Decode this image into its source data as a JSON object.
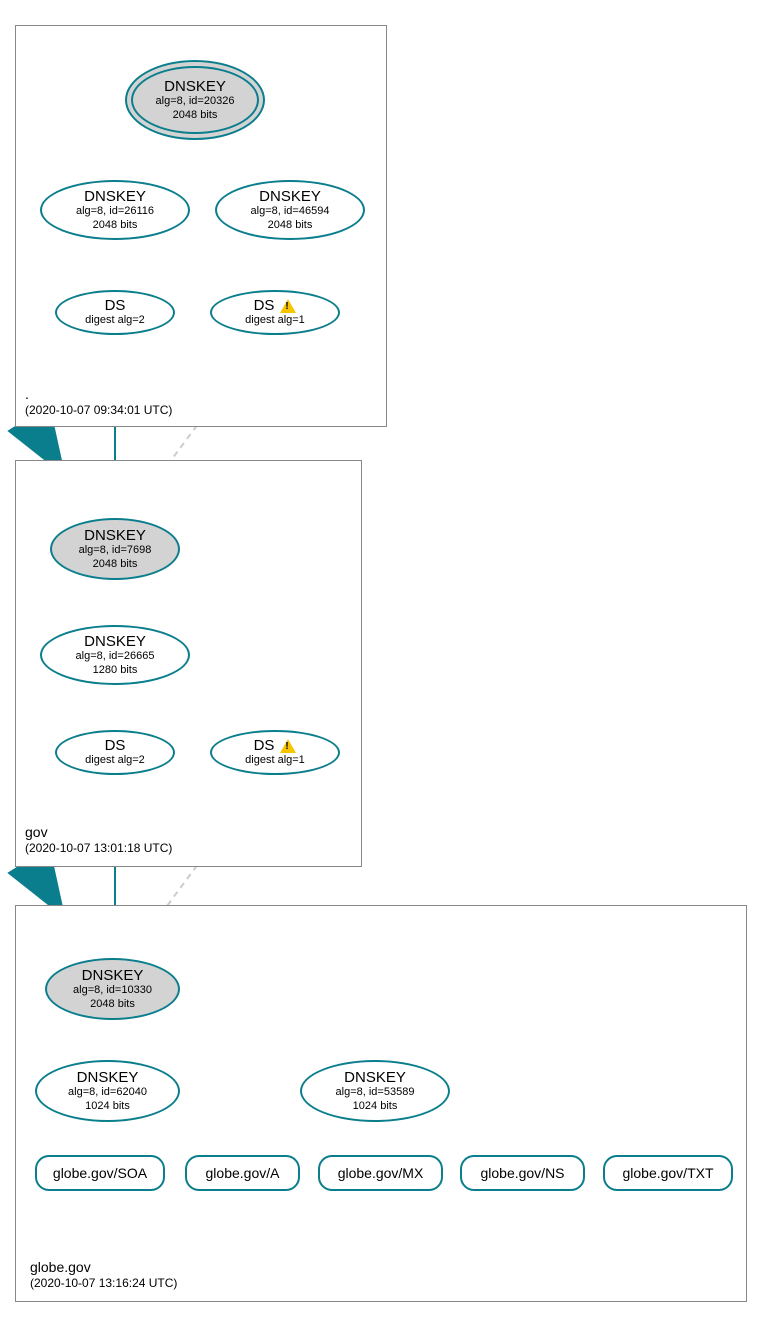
{
  "colors": {
    "stroke": "#0a7e8c",
    "faded": "#cccccc"
  },
  "zones": {
    "root": {
      "name": ".",
      "timestamp": "(2020-10-07 09:34:01 UTC)"
    },
    "gov": {
      "name": "gov",
      "timestamp": "(2020-10-07 13:01:18 UTC)"
    },
    "globe": {
      "name": "globe.gov",
      "timestamp": "(2020-10-07 13:16:24 UTC)"
    }
  },
  "root": {
    "ksk": {
      "title": "DNSKEY",
      "line1": "alg=8, id=20326",
      "line2": "2048 bits"
    },
    "zsk1": {
      "title": "DNSKEY",
      "line1": "alg=8, id=26116",
      "line2": "2048 bits"
    },
    "zsk2": {
      "title": "DNSKEY",
      "line1": "alg=8, id=46594",
      "line2": "2048 bits"
    },
    "ds1": {
      "title": "DS",
      "line1": "digest alg=2"
    },
    "ds2": {
      "title": "DS",
      "line1": "digest alg=1"
    }
  },
  "gov": {
    "ksk": {
      "title": "DNSKEY",
      "line1": "alg=8, id=7698",
      "line2": "2048 bits"
    },
    "zsk": {
      "title": "DNSKEY",
      "line1": "alg=8, id=26665",
      "line2": "1280 bits"
    },
    "ds1": {
      "title": "DS",
      "line1": "digest alg=2"
    },
    "ds2": {
      "title": "DS",
      "line1": "digest alg=1"
    }
  },
  "globe": {
    "ksk": {
      "title": "DNSKEY",
      "line1": "alg=8, id=10330",
      "line2": "2048 bits"
    },
    "zsk1": {
      "title": "DNSKEY",
      "line1": "alg=8, id=62040",
      "line2": "1024 bits"
    },
    "zsk2": {
      "title": "DNSKEY",
      "line1": "alg=8, id=53589",
      "line2": "1024 bits"
    },
    "rr": {
      "soa": "globe.gov/SOA",
      "a": "globe.gov/A",
      "mx": "globe.gov/MX",
      "ns": "globe.gov/NS",
      "txt": "globe.gov/TXT"
    }
  }
}
